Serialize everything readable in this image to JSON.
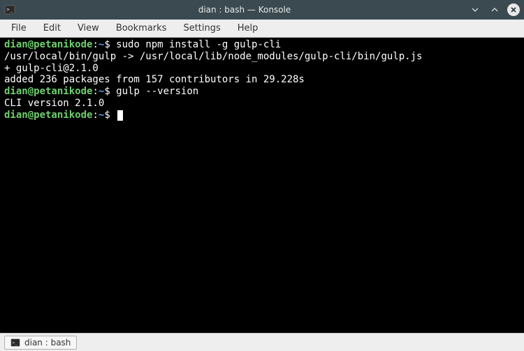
{
  "window": {
    "title": "dian : bash — Konsole"
  },
  "menu": {
    "file": "File",
    "edit": "Edit",
    "view": "View",
    "bookmarks": "Bookmarks",
    "settings": "Settings",
    "help": "Help"
  },
  "terminal": {
    "prompt_user_host": "dian@petanikode",
    "prompt_colon": ":",
    "prompt_path": "~",
    "prompt_dollar": "$ ",
    "lines": [
      {
        "cmd": "sudo npm install -g gulp-cli"
      },
      {
        "out": "/usr/local/bin/gulp -> /usr/local/lib/node_modules/gulp-cli/bin/gulp.js"
      },
      {
        "out": "+ gulp-cli@2.1.0"
      },
      {
        "out": "added 236 packages from 157 contributors in 29.228s"
      },
      {
        "cmd": "gulp --version"
      },
      {
        "out": "CLI version 2.1.0"
      },
      {
        "cmd": ""
      }
    ]
  },
  "status": {
    "tab_label": "dian : bash"
  }
}
